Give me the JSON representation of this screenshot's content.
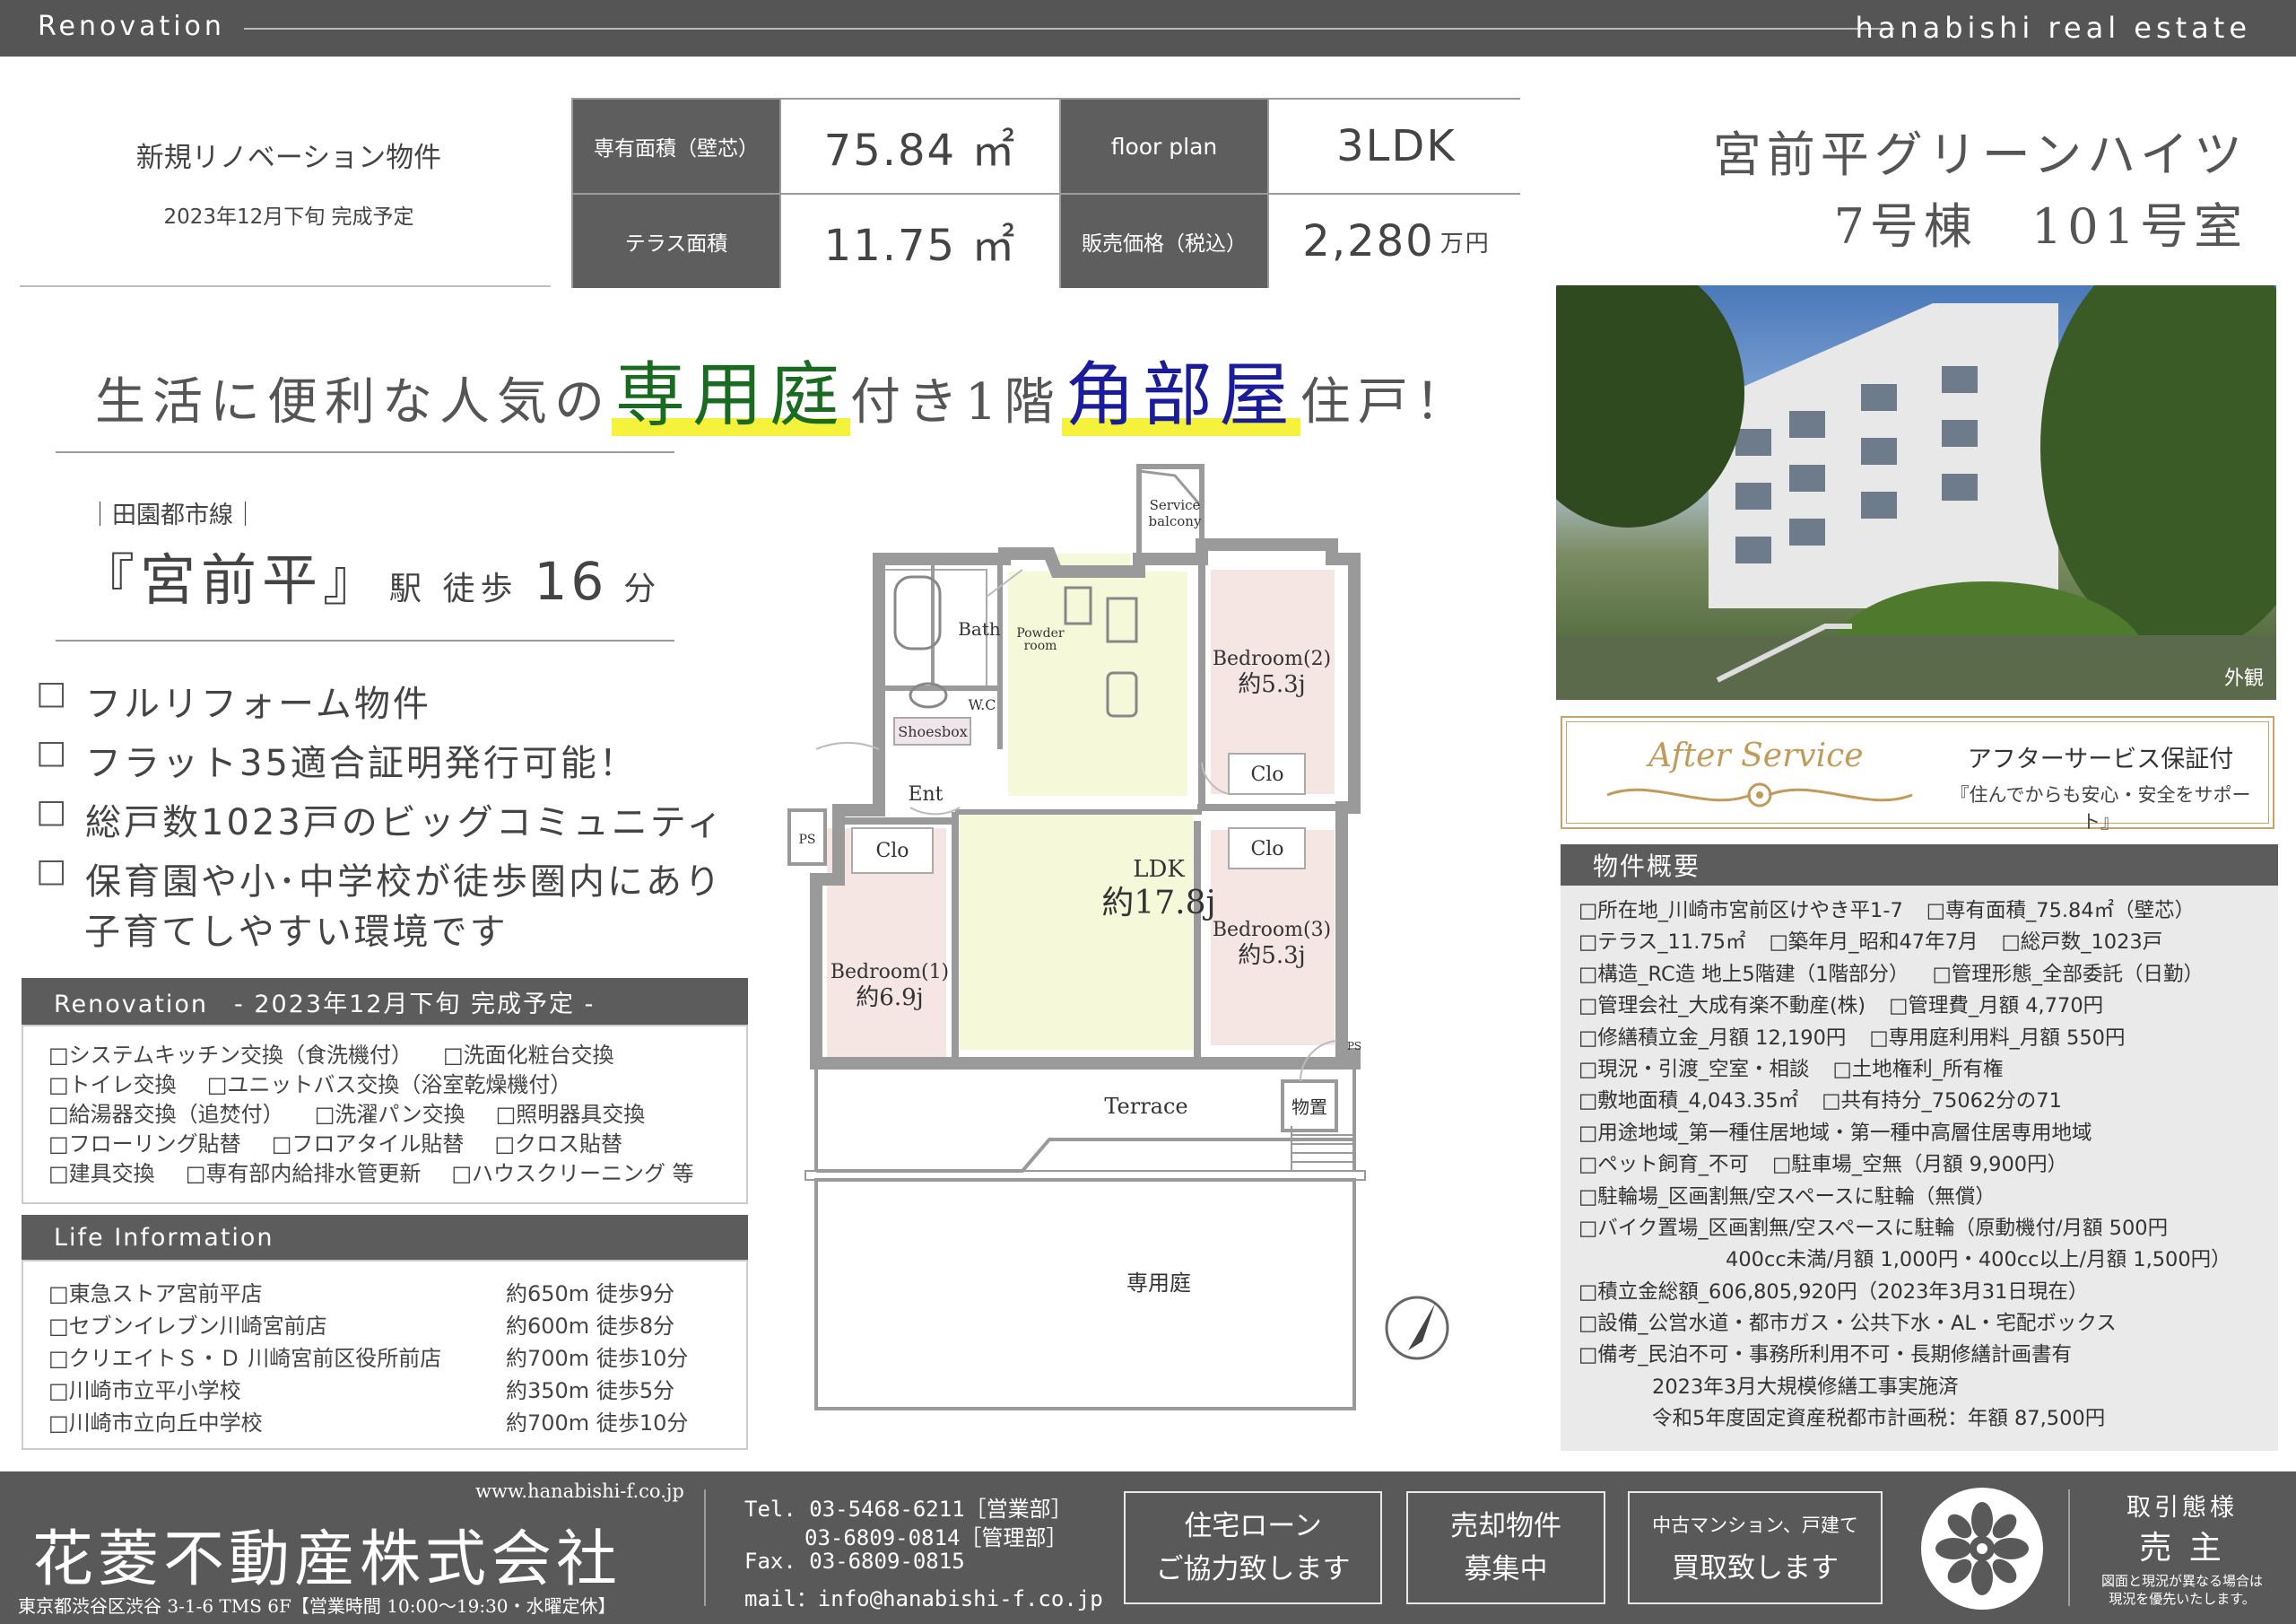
{
  "header": {
    "left_label": "Renovation",
    "right_label": "hanabishi real estate"
  },
  "intro": {
    "title": "新規リノベーション物件",
    "completion": "2023年12月下旬 完成予定"
  },
  "specs": {
    "area_label": "専有面積（壁芯）",
    "area_value": "75.84 ㎡",
    "floorplan_label": "floor plan",
    "floorplan_value": "3LDK",
    "terrace_label": "テラス面積",
    "terrace_value": "11.75 ㎡",
    "price_label": "販売価格（税込）",
    "price_value": "2,280",
    "price_unit": "万円"
  },
  "property": {
    "name": "宮前平グリーンハイツ",
    "unit": "7号棟　101号室"
  },
  "catch": {
    "part1": "生活に便利な人気の",
    "hl1": "専用庭",
    "part2": "付き1階",
    "hl2": "角部屋",
    "part3": "住戸！"
  },
  "access": {
    "line": "｜田園都市線｜",
    "station": "『宮前平』",
    "suffix": "駅 徒歩",
    "minutes": "16",
    "min_unit": "分"
  },
  "features": [
    "フルリフォーム物件",
    "フラット35適合証明発行可能！",
    "総戸数1023戸のビッグコミュニティ",
    "保育園や小･中学校が徒歩圏内にあり",
    "子育てしやすい環境です"
  ],
  "renovation": {
    "heading": "Renovation　- 2023年12月下旬 完成予定 -",
    "lines": [
      [
        "□システムキッチン交換（食洗機付）",
        "□洗面化粧台交換"
      ],
      [
        "□トイレ交換",
        "□ユニットバス交換（浴室乾燥機付）"
      ],
      [
        "□給湯器交換（追焚付）",
        "□洗濯パン交換",
        "□照明器具交換"
      ],
      [
        "□フローリング貼替",
        "□フロアタイル貼替",
        "□クロス貼替"
      ],
      [
        "□建具交換",
        "□専有部内給排水管更新",
        "□ハウスクリーニング 等"
      ]
    ]
  },
  "life": {
    "heading": "Life Information",
    "items": [
      {
        "name": "□東急ストア宮前平店",
        "dist": "約650m 徒歩9分"
      },
      {
        "name": "□セブンイレブン川崎宮前店",
        "dist": "約600m 徒歩8分"
      },
      {
        "name": "□クリエイトＳ・Ｄ 川崎宮前区役所前店",
        "dist": "約700m 徒歩10分"
      },
      {
        "name": "□川崎市立平小学校",
        "dist": "約350m 徒歩5分"
      },
      {
        "name": "□川崎市立向丘中学校",
        "dist": "約700m 徒歩10分"
      }
    ]
  },
  "floorplan": {
    "service_balcony": [
      "Service",
      "balcony"
    ],
    "bath": "Bath",
    "powder_room": [
      "Powder",
      "room"
    ],
    "wc": "W.C",
    "shoesbox": "Shoesbox",
    "ent": "Ent",
    "ps": "PS",
    "clo": "Clo",
    "bed1": "Bedroom(1)",
    "bed1_size": "約6.9j",
    "bed2": "Bedroom(2)",
    "bed2_size": "約5.3j",
    "bed3": "Bedroom(3)",
    "bed3_size": "約5.3j",
    "ldk": "LDK",
    "ldk_size": "約17.8j",
    "terrace": "Terrace",
    "storage": "物置",
    "garden": "専用庭"
  },
  "photo": {
    "caption": "外観"
  },
  "after_service": {
    "logo": "After Service",
    "title": "アフターサービス保証付",
    "subtitle": "『住んでからも安心・安全をサポート』"
  },
  "outline": {
    "heading": "物件概要",
    "lines": [
      [
        "□所在地_川崎市宮前区けやき平1-7",
        "□専有面積_75.84㎡（壁芯）"
      ],
      [
        "□テラス_11.75㎡",
        "□築年月_昭和47年7月",
        "□総戸数_1023戸"
      ],
      [
        "□構造_RC造 地上5階建（1階部分）",
        "□管理形態_全部委託（日勤）"
      ],
      [
        "□管理会社_大成有楽不動産(株)",
        "□管理費_月額 4,770円"
      ],
      [
        "□修繕積立金_月額 12,190円",
        "□専用庭利用料_月額 550円"
      ],
      [
        "□現況・引渡_空室・相談",
        "□土地権利_所有権"
      ],
      [
        "□敷地面積_4,043.35㎡",
        "□共有持分_75062分の71"
      ],
      [
        "□用途地域_第一種住居地域・第一種中高層住居専用地域"
      ],
      [
        "□ペット飼育_不可",
        "□駐車場_空無（月額 9,900円）"
      ],
      [
        "□駐輪場_区画割無/空スペースに駐輪（無償）"
      ],
      [
        "□バイク置場_区画割無/空スペースに駐輪（原動機付/月額 500円"
      ],
      [
        "400cc未満/月額 1,000円・400cc以上/月額 1,500円）"
      ],
      [
        "□積立金総額_606,805,920円（2023年3月31日現在）"
      ],
      [
        "□設備_公営水道・都市ガス・公共下水・AL・宅配ボックス"
      ],
      [
        "□備考_民泊不可・事務所利用不可・長期修繕計画書有"
      ],
      [
        "2023年3月大規模修繕工事実施済"
      ],
      [
        "令和5年度固定資産税都市計画税：年額 87,500円"
      ]
    ]
  },
  "footer": {
    "url": "www.hanabishi-f.co.jp",
    "company": "花菱不動産株式会社",
    "address": "東京都渋谷区渋谷 3-1-6 TMS 6F【営業時間 10:00～19:30・水曜定休】",
    "tel1": "Tel. 03-5468-6211［営業部］",
    "tel2": "03-6809-0814［管理部］",
    "fax": "Fax. 03-6809-0815",
    "mail": "mail：info@hanabishi-f.co.jp",
    "box1": [
      "住宅ローン",
      "ご協力致します"
    ],
    "box2": [
      "売却物件",
      "募集中"
    ],
    "box3": [
      "中古マンション、戸建て",
      "買取致します"
    ],
    "deal_label": "取引態様",
    "deal_value": "売 主",
    "note": [
      "図面と現況が異なる場合は",
      "現況を優先いたします。"
    ]
  },
  "colors": {
    "dark_gray": "#595959",
    "highlight_yellow": "#f4f23a",
    "garden_green": "#1a6b22",
    "corner_navy": "#1b1c9a",
    "ldk_fill": "#f6f9d9",
    "bedroom_fill": "#f5e6e3"
  }
}
